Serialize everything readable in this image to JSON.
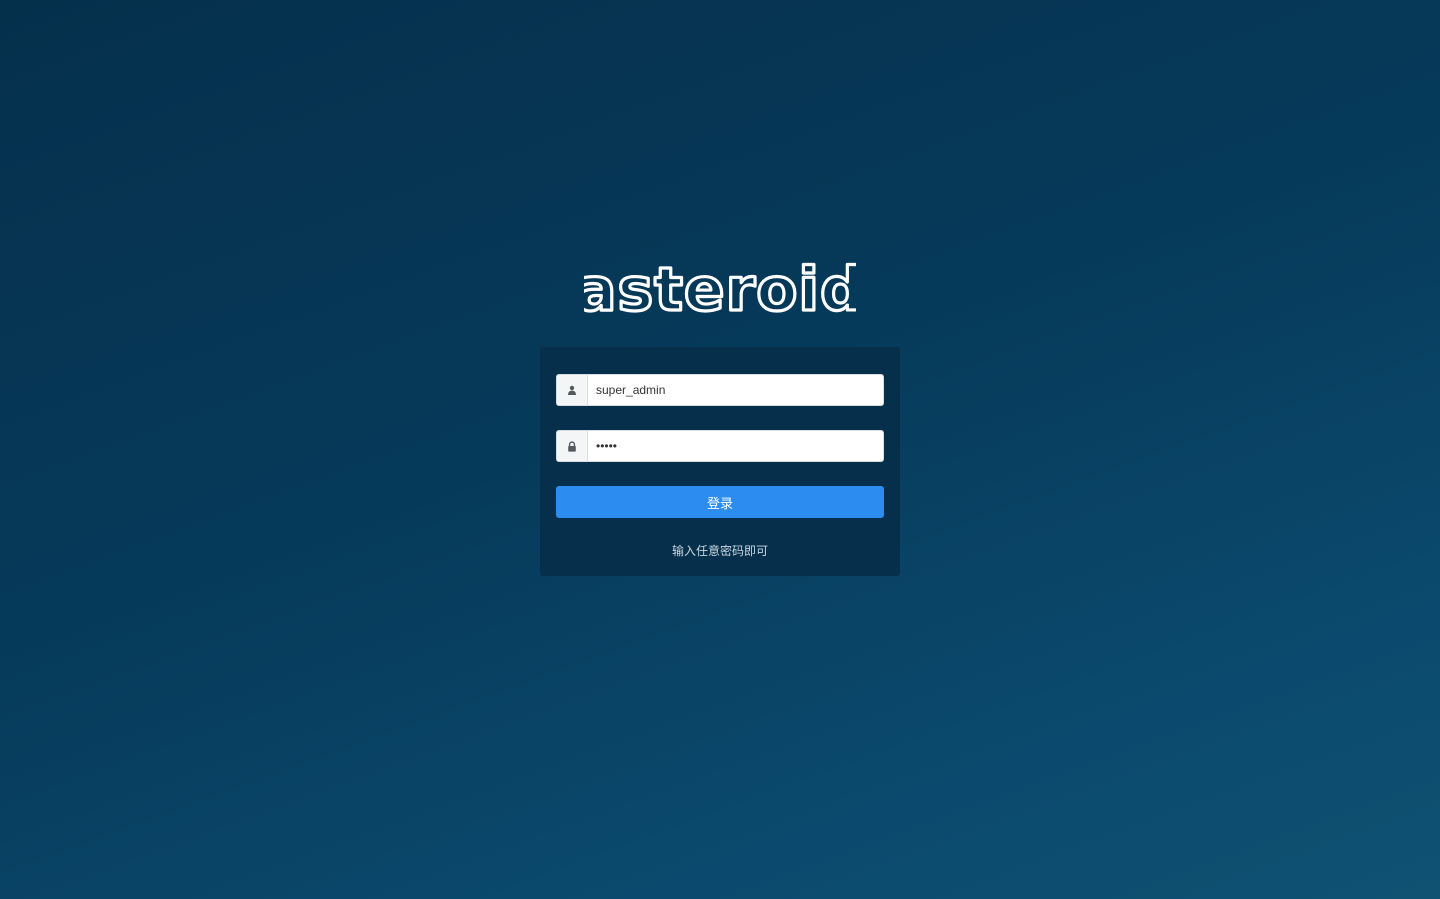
{
  "logo": {
    "text": "asteroid"
  },
  "login_form": {
    "username": {
      "value": "super_admin",
      "icon": "user-icon"
    },
    "password": {
      "value": "•••••",
      "icon": "lock-icon"
    },
    "submit_label": "登录",
    "hint": "输入任意密码即可"
  },
  "colors": {
    "background_top": "#05304c",
    "background_bottom": "#0f5272",
    "card": "#062f4b",
    "primary_button": "#2d8cf0"
  }
}
